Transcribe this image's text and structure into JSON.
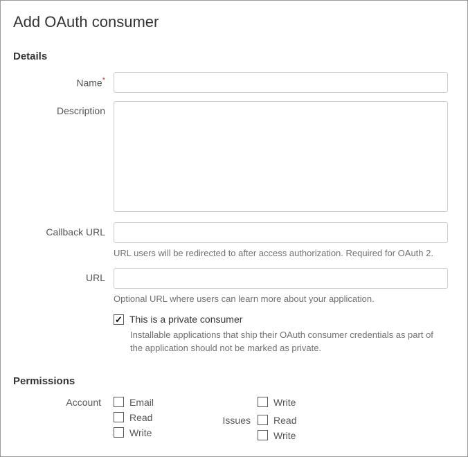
{
  "page_title": "Add OAuth consumer",
  "sections": {
    "details": {
      "heading": "Details",
      "name": {
        "label": "Name",
        "required": true,
        "value": ""
      },
      "description": {
        "label": "Description",
        "value": ""
      },
      "callback_url": {
        "label": "Callback URL",
        "value": "",
        "help": "URL users will be redirected to after access authorization. Required for OAuth 2."
      },
      "url": {
        "label": "URL",
        "value": "",
        "help": "Optional URL where users can learn more about your application."
      },
      "private_consumer": {
        "checked": true,
        "label": "This is a private consumer",
        "help": "Installable applications that ship their OAuth consumer credentials as part of the application should not be marked as private."
      }
    },
    "permissions": {
      "heading": "Permissions",
      "account": {
        "label": "Account",
        "options": [
          {
            "label": "Email",
            "checked": false
          },
          {
            "label": "Read",
            "checked": false
          },
          {
            "label": "Write",
            "checked": false
          }
        ]
      },
      "right_col_top": {
        "options": [
          {
            "label": "Write",
            "checked": false
          }
        ]
      },
      "issues": {
        "label": "Issues",
        "options": [
          {
            "label": "Read",
            "checked": false
          },
          {
            "label": "Write",
            "checked": false
          }
        ]
      }
    }
  }
}
